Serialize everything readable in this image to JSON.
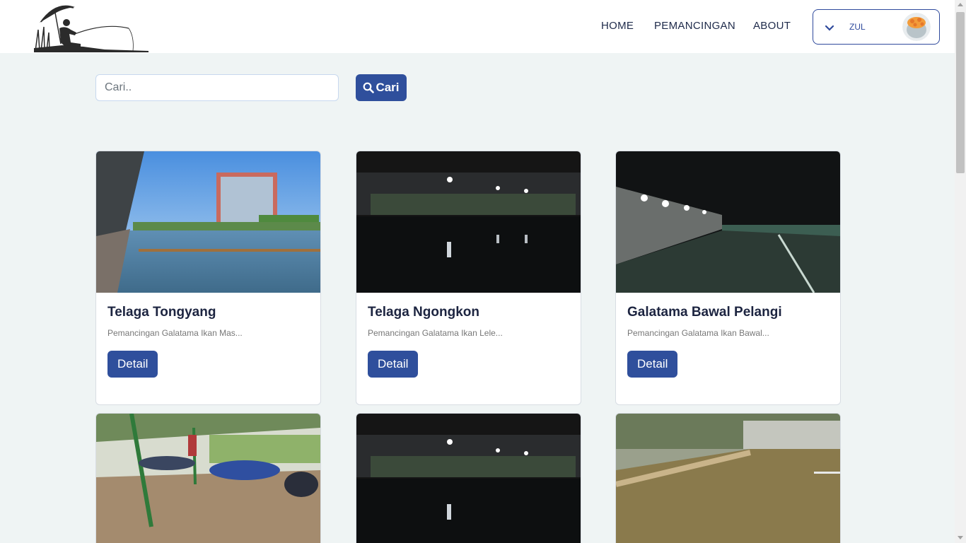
{
  "nav": {
    "links": [
      "HOME",
      "PEMANCINGAN",
      "ABOUT"
    ],
    "user": {
      "name": "ZUL"
    }
  },
  "search": {
    "placeholder": "Cari..",
    "button_label": "Cari"
  },
  "cards": [
    {
      "title": "Telaga Tongyang",
      "description": "Pemancingan Galatama Ikan Mas...",
      "button": "Detail"
    },
    {
      "title": "Telaga Ngongkon",
      "description": "Pemancingan Galatama Ikan Lele...",
      "button": "Detail"
    },
    {
      "title": "Galatama Bawal Pelangi",
      "description": "Pemancingan Galatama Ikan Bawal...",
      "button": "Detail"
    },
    {
      "title": "",
      "description": "",
      "button": ""
    },
    {
      "title": "",
      "description": "",
      "button": ""
    },
    {
      "title": "",
      "description": "",
      "button": ""
    }
  ],
  "colors": {
    "primary": "#2f4f9c",
    "background": "#eff4f4",
    "nav_text": "#1e2a4a"
  }
}
